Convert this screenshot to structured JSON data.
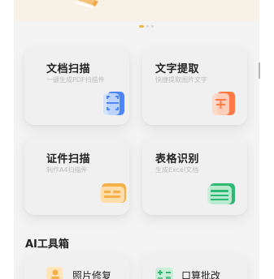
{
  "colors": {
    "accent": "#f1b743",
    "blue": "#4f86f7",
    "orange": "#ff7a45",
    "gold": "#f6b04a",
    "green": "#2fb774"
  },
  "carousel": {
    "page_count": 3,
    "active_index": 0
  },
  "cards": [
    {
      "title": "文档扫描",
      "subtitle": "一键生成PDF扫描件",
      "icon": "scan-document-icon"
    },
    {
      "title": "文字提取",
      "subtitle": "快捷提取图片文字",
      "icon": "text-extract-icon"
    },
    {
      "title": "证件扫描",
      "subtitle": "制作A4扫描件",
      "icon": "id-card-icon"
    },
    {
      "title": "表格识别",
      "subtitle": "生成Excel文档",
      "icon": "table-icon"
    }
  ],
  "ai_tools": {
    "title": "AI工具箱",
    "items": [
      {
        "label": "照片修复",
        "icon": "photo-restore-icon"
      },
      {
        "label": "口算批改",
        "icon": "math-check-icon"
      }
    ]
  }
}
